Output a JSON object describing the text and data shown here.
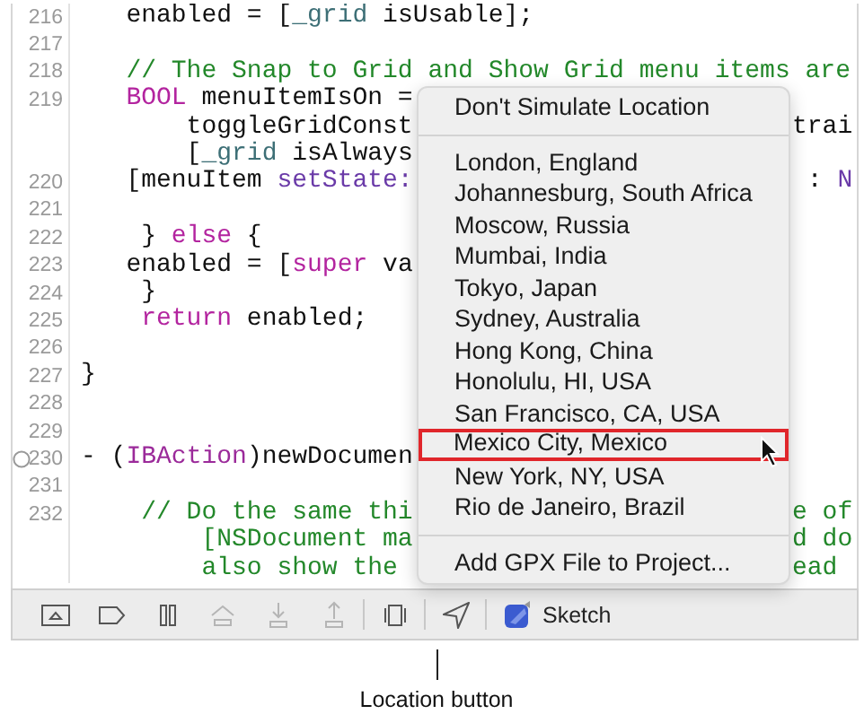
{
  "editor": {
    "lines": [
      {
        "number": "216",
        "left": [
          {
            "kind": "plain",
            "text": "   enabled = ["
          },
          {
            "kind": "ivar",
            "text": "_grid"
          },
          {
            "kind": "plain",
            "text": " isUsable];"
          }
        ]
      },
      {
        "number": "217"
      },
      {
        "number": "218",
        "left": [
          {
            "kind": "comment",
            "text": "   // The Snap to Grid and Show Grid menu items are"
          }
        ]
      },
      {
        "number": "219",
        "left": [
          {
            "kind": "keyword",
            "text": "   BOOL"
          },
          {
            "kind": "plain",
            "text": " menuItemIsOn ="
          }
        ]
      },
      {
        "left": [
          {
            "kind": "plain",
            "text": "       toggleGridConst"
          }
        ],
        "right": [
          {
            "kind": "plain",
            "text": "trai"
          }
        ]
      },
      {
        "left": [
          {
            "kind": "plain",
            "text": "       ["
          },
          {
            "kind": "ivar",
            "text": "_grid"
          },
          {
            "kind": "plain",
            "text": " isAlways"
          }
        ]
      },
      {
        "number": "220",
        "left": [
          {
            "kind": "plain",
            "text": "   [menuItem "
          },
          {
            "kind": "method",
            "text": "setState:"
          }
        ],
        "right": [
          {
            "kind": "plain",
            "text": " : "
          },
          {
            "kind": "method",
            "text": "N"
          }
        ]
      },
      {
        "number": "221"
      },
      {
        "number": "222",
        "left": [
          {
            "kind": "plain",
            "text": "    } "
          },
          {
            "kind": "keyword",
            "text": "else"
          },
          {
            "kind": "plain",
            "text": " {"
          }
        ]
      },
      {
        "number": "223",
        "left": [
          {
            "kind": "plain",
            "text": "   enabled = ["
          },
          {
            "kind": "keyword",
            "text": "super"
          },
          {
            "kind": "plain",
            "text": " va"
          }
        ]
      },
      {
        "number": "224",
        "left": [
          {
            "kind": "plain",
            "text": "    }"
          }
        ]
      },
      {
        "number": "225",
        "left": [
          {
            "kind": "keyword",
            "text": "    return"
          },
          {
            "kind": "plain",
            "text": " enabled;"
          }
        ]
      },
      {
        "number": "226"
      },
      {
        "number": "227",
        "left": [
          {
            "kind": "plain",
            "text": "}"
          }
        ]
      },
      {
        "number": "228"
      },
      {
        "number": "229"
      },
      {
        "number": "230",
        "marker": true,
        "left": [
          {
            "kind": "plain",
            "text": "- ("
          },
          {
            "kind": "macro",
            "text": "IBAction"
          },
          {
            "kind": "plain",
            "text": ")newDocumen"
          }
        ]
      },
      {
        "number": "231"
      },
      {
        "number": "232",
        "left": [
          {
            "kind": "comment",
            "text": "    // Do the same thi"
          }
        ],
        "right": [
          {
            "kind": "comment",
            "text": "e of"
          }
        ]
      },
      {
        "left": [
          {
            "kind": "comment",
            "text": "        [NSDocument ma"
          }
        ],
        "right": [
          {
            "kind": "comment",
            "text": "d do"
          }
        ]
      },
      {
        "left": [
          {
            "kind": "comment",
            "text": "        also show the"
          }
        ],
        "right": [
          {
            "kind": "comment",
            "text": "ead"
          }
        ]
      }
    ]
  },
  "location_menu": {
    "items": [
      {
        "kind": "item",
        "label": "Don't Simulate Location",
        "outlined": false
      },
      {
        "kind": "separator"
      },
      {
        "kind": "item",
        "label": "London, England",
        "outlined": false
      },
      {
        "kind": "item",
        "label": "Johannesburg, South Africa",
        "outlined": false
      },
      {
        "kind": "item",
        "label": "Moscow, Russia",
        "outlined": false
      },
      {
        "kind": "item",
        "label": "Mumbai, India",
        "outlined": false
      },
      {
        "kind": "item",
        "label": "Tokyo, Japan",
        "outlined": false
      },
      {
        "kind": "item",
        "label": "Sydney, Australia",
        "outlined": false
      },
      {
        "kind": "item",
        "label": "Hong Kong, China",
        "outlined": false
      },
      {
        "kind": "item",
        "label": "Honolulu, HI, USA",
        "outlined": false
      },
      {
        "kind": "item",
        "label": "San Francisco, CA, USA",
        "outlined": false
      },
      {
        "kind": "item",
        "label": "Mexico City, Mexico",
        "outlined": true
      },
      {
        "kind": "item",
        "label": "New York, NY, USA",
        "outlined": false
      },
      {
        "kind": "item",
        "label": "Rio de Janeiro, Brazil",
        "outlined": false
      },
      {
        "kind": "separator"
      },
      {
        "kind": "item",
        "label": "Add GPX File to Project...",
        "outlined": false
      }
    ]
  },
  "debug_bar": {
    "items": [
      {
        "kind": "hide-panel",
        "disabled": false
      },
      {
        "kind": "breakpoints",
        "disabled": false
      },
      {
        "kind": "pause",
        "disabled": false
      },
      {
        "kind": "step-over",
        "disabled": true
      },
      {
        "kind": "step-in",
        "disabled": true
      },
      {
        "kind": "step-out",
        "disabled": true
      },
      {
        "kind": "divider"
      },
      {
        "kind": "view-hierarchy",
        "disabled": false
      },
      {
        "kind": "divider"
      },
      {
        "kind": "location",
        "disabled": false
      },
      {
        "kind": "divider"
      },
      {
        "kind": "app",
        "label": "Sketch"
      }
    ]
  },
  "callout": {
    "label": "Location button"
  }
}
